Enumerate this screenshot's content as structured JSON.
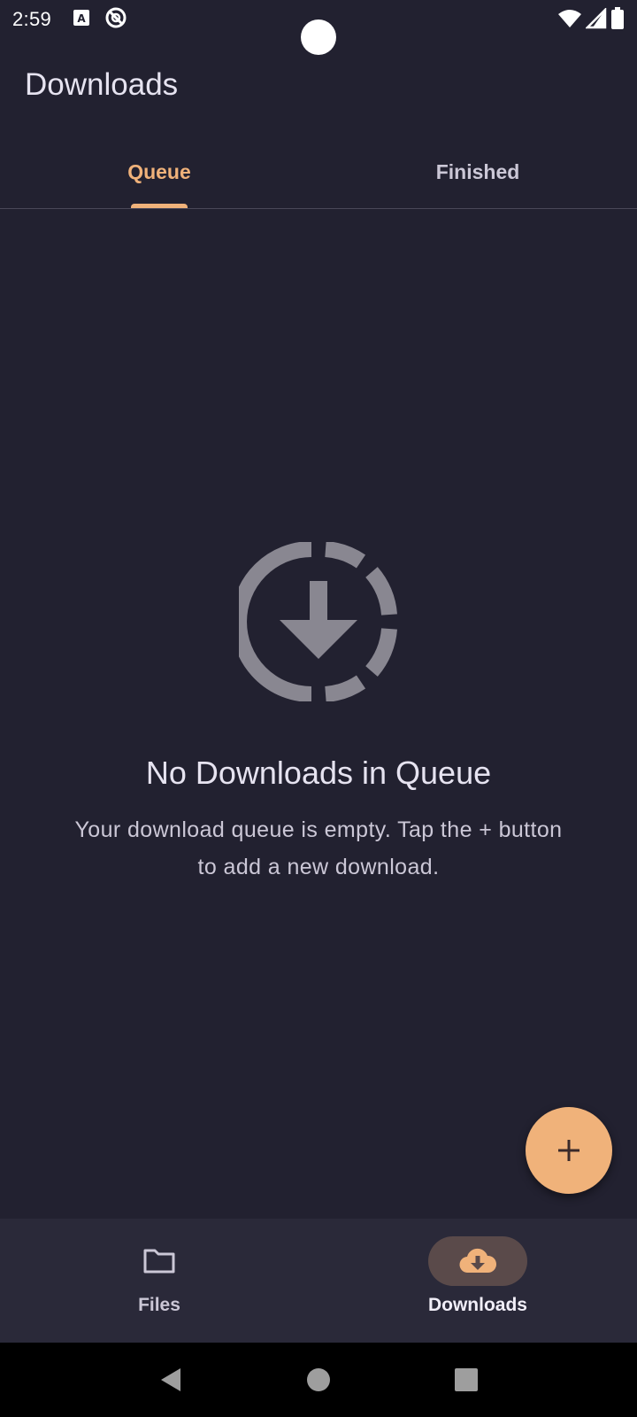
{
  "status_bar": {
    "time": "2:59",
    "icons": [
      "a11y-notification-icon",
      "no-sync-icon",
      "wifi-icon",
      "cell-signal-icon",
      "battery-icon"
    ]
  },
  "app_bar": {
    "title": "Downloads"
  },
  "tabs": [
    {
      "label": "Queue",
      "active": true
    },
    {
      "label": "Finished",
      "active": false
    }
  ],
  "empty_state": {
    "icon": "download-in-progress-icon",
    "title": "No Downloads in Queue",
    "message": "Your download queue is empty. Tap the + button to add a new download."
  },
  "fab": {
    "icon": "plus-icon"
  },
  "bottom_nav": [
    {
      "label": "Files",
      "icon": "folder-icon",
      "active": false
    },
    {
      "label": "Downloads",
      "icon": "cloud-download-icon",
      "active": true
    }
  ],
  "colors": {
    "background": "#222130",
    "accent": "#f0b27a",
    "nav_background": "#2a2939",
    "active_pill": "#5a4a4a",
    "text_primary": "#e6e3f0",
    "text_secondary": "#cbc7d6"
  }
}
